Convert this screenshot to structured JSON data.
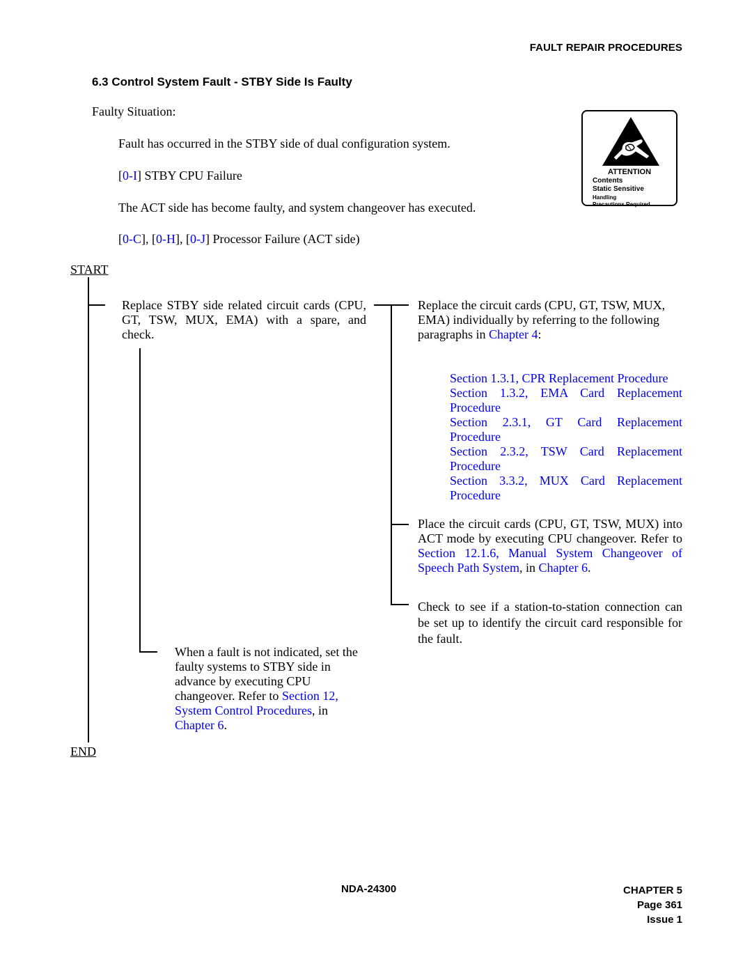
{
  "header": {
    "running_title": "FAULT REPAIR PROCEDURES",
    "section_title": "6.3  Control System Fault - STBY Side Is Faulty"
  },
  "situation": {
    "label": "Faulty Situation:",
    "description": "Fault has occurred in the STBY side of dual configuration system.",
    "condition1": {
      "codes": [
        "0-I"
      ],
      "text": "STBY CPU Failure"
    },
    "act_description": "The ACT side has become faulty, and system changeover has executed.",
    "condition2": {
      "codes": [
        "0-C",
        "0-H",
        "0-J"
      ],
      "text": "Processor Failure (ACT side)"
    }
  },
  "attention_label": {
    "icon": "esd-warning-hand-icon",
    "title": "ATTENTION",
    "line1": "Contents",
    "line2": "Static Sensitive",
    "line3": "Handling",
    "line4": "Precautions Required"
  },
  "flowchart": {
    "start": "START",
    "end": "END",
    "step1": "Replace STBY side related circuit cards (CPU, GT, TSW, MUX, EMA) with a spare, and check.",
    "step2": {
      "text": "Replace the circuit cards (CPU, GT, TSW, MUX, EMA) individually by referring to the following paragraphs in ",
      "link": "Chapter 4",
      "suffix": ":"
    },
    "references": [
      "Section 1.3.1, CPR Replacement Procedure",
      "Section 1.3.2, EMA Card Replacement Procedure",
      "Section 2.3.1, GT Card Replacement Procedure",
      "Section 2.3.2, TSW Card Replacement Procedure",
      "Section 3.3.2, MUX Card Replacement Procedure"
    ],
    "step3": {
      "text": "Place the circuit cards (CPU, GT, TSW, MUX) into ACT mode by executing CPU changeover. Refer to ",
      "link1": "Section 12.1.6, Manual System Changeover of Speech Path System",
      "mid": ", in ",
      "link2": "Chapter 6",
      "suffix": "."
    },
    "step4": "Check to see if a station-to-station connection can be set up to identify the circuit card responsible for the fault.",
    "step5": {
      "text": "When a fault is not indicated, set the faulty systems to STBY side in advance by executing CPU changeover. Refer to ",
      "link1": "Section 12, System Control Procedures",
      "mid": ", in ",
      "link2": "Chapter 6",
      "suffix": "."
    }
  },
  "footer": {
    "document": "NDA-24300",
    "chapter": "CHAPTER 5",
    "page": "Page 361",
    "issue": "Issue 1"
  },
  "colors": {
    "link": "#0000ee",
    "text": "#000000"
  }
}
